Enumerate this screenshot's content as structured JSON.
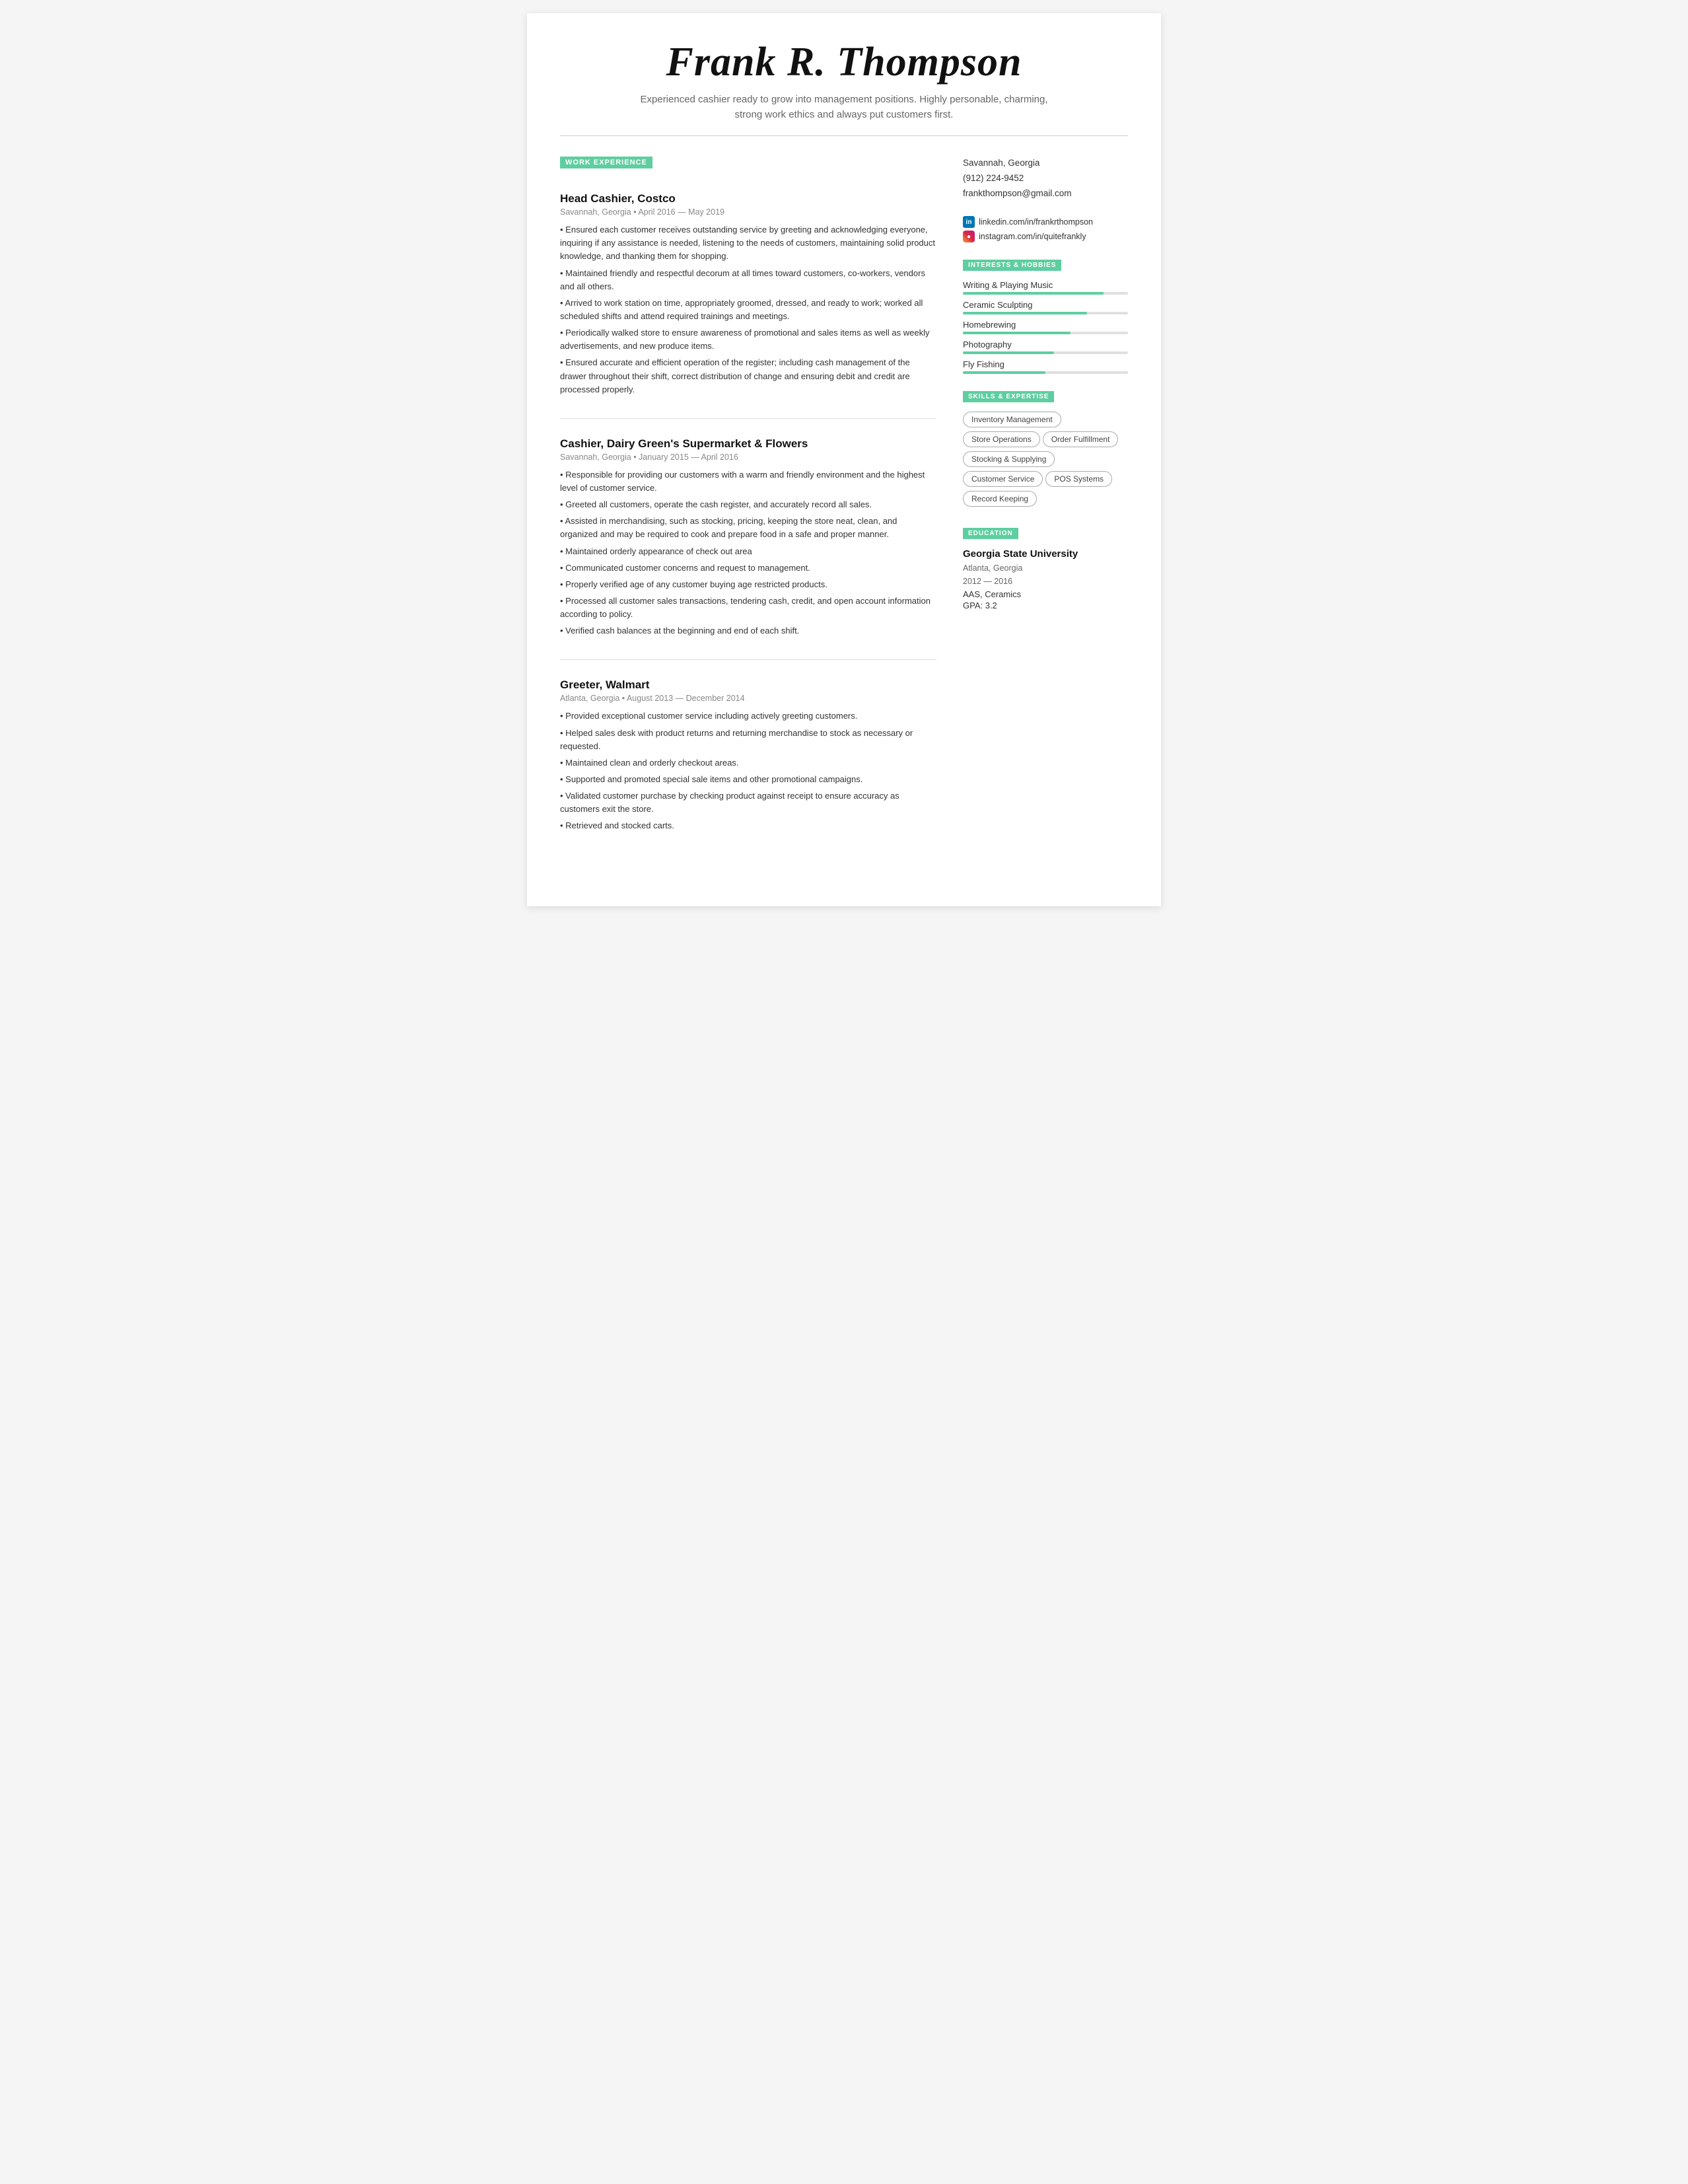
{
  "header": {
    "name": "Frank R. Thompson",
    "tagline": "Experienced cashier ready to grow into management positions. Highly personable, charming, strong work ethics and always put customers first."
  },
  "contact": {
    "location": "Savannah, Georgia",
    "phone": "(912) 224-9452",
    "email": "frankthompson@gmail.com",
    "linkedin": "linkedin.com/in/frankrthompson",
    "instagram": "instagram.com/in/quitefrankly"
  },
  "sections": {
    "work_experience_label": "WORK EXPERIENCE",
    "interests_label": "INTERESTS & HOBBIES",
    "skills_label": "SKILLS & EXPERTISE",
    "education_label": "EDUCATION"
  },
  "jobs": [
    {
      "title": "Head Cashier, Costco",
      "meta": "Savannah, Georgia • April 2016 — May 2019",
      "bullets": [
        "• Ensured each customer receives outstanding service by greeting and acknowledging everyone, inquiring if any assistance is needed, listening to the needs of customers, maintaining solid product knowledge, and thanking them for shopping.",
        "• Maintained friendly and respectful decorum at all times toward customers, co-workers, vendors and all others.",
        "• Arrived to work station on time, appropriately groomed, dressed, and ready to work; worked all scheduled shifts and attend required trainings and meetings.",
        "• Periodically walked store to ensure awareness of promotional and sales items as well as weekly advertisements, and new produce items.",
        "• Ensured accurate and efficient operation of the register; including cash management of the drawer throughout their shift, correct distribution of change and ensuring debit and credit are processed properly."
      ]
    },
    {
      "title": "Cashier, Dairy Green's Supermarket & Flowers",
      "meta": "Savannah, Georgia • January 2015 — April 2016",
      "bullets": [
        "• Responsible for providing our customers with a warm and friendly environment and the highest level of customer service.",
        "• Greeted all customers, operate the cash register, and accurately record all sales.",
        "• Assisted in merchandising, such as stocking, pricing, keeping the store neat, clean, and organized and may be required to cook and prepare food in a safe and proper manner.",
        "• Maintained orderly appearance of check out area",
        "• Communicated customer concerns and request to management.",
        "• Properly verified age of any customer buying age restricted products.",
        "• Processed all customer sales transactions, tendering cash, credit, and open account information according to policy.",
        "• Verified cash balances at the beginning and end of each shift."
      ]
    },
    {
      "title": "Greeter, Walmart",
      "meta": "Atlanta, Georgia • August 2013 — December 2014",
      "bullets": [
        "• Provided exceptional customer service including actively greeting customers.",
        "• Helped sales desk with product returns and returning merchandise to stock as necessary or requested.",
        "• Maintained clean and orderly checkout areas.",
        "• Supported and promoted special sale items and other promotional campaigns.",
        "• Validated customer purchase by checking product against receipt to ensure accuracy as customers exit the store.",
        "• Retrieved and stocked carts."
      ]
    }
  ],
  "interests": [
    {
      "name": "Writing & Playing Music",
      "pct": 85
    },
    {
      "name": "Ceramic Sculpting",
      "pct": 75
    },
    {
      "name": "Homebrewing",
      "pct": 65
    },
    {
      "name": "Photography",
      "pct": 55
    },
    {
      "name": "Fly Fishing",
      "pct": 50
    }
  ],
  "skills": [
    "Inventory Management",
    "Store Operations",
    "Order Fulfillment",
    "Stocking & Supplying",
    "Customer Service",
    "POS Systems",
    "Record Keeping"
  ],
  "education": {
    "school": "Georgia State University",
    "location": "Atlanta, Georgia",
    "years": "2012 — 2016",
    "degree": "AAS, Ceramics",
    "gpa": "GPA: 3.2"
  }
}
